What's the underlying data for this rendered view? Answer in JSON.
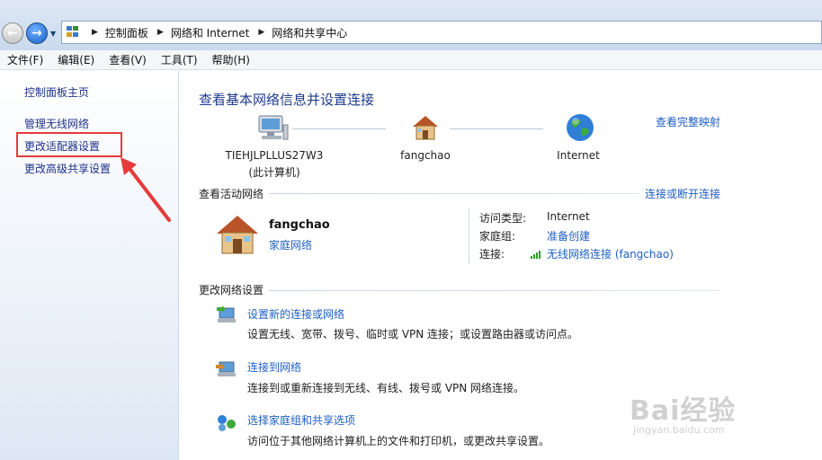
{
  "address_bar": {
    "crumbs": [
      "控制面板",
      "网络和 Internet",
      "网络和共享中心"
    ]
  },
  "menu": [
    "文件(F)",
    "编辑(E)",
    "查看(V)",
    "工具(T)",
    "帮助(H)"
  ],
  "sidebar": {
    "home": "控制面板主页",
    "items": [
      "管理无线网络",
      "更改适配器设置",
      "更改高级共享设置"
    ],
    "highlighted_item": "更改适配器设置",
    "highlight_color": "#e53b3b"
  },
  "main": {
    "title": "查看基本网络信息并设置连接",
    "full_map_link": "查看完整映射",
    "map": {
      "computer": {
        "name": "TIEHJLPLLUS27W3",
        "note": "(此计算机)"
      },
      "network": {
        "name": "fangchao"
      },
      "internet": {
        "name": "Internet"
      }
    },
    "active": {
      "heading": "查看活动网络",
      "link": "连接或断开连接",
      "network_name": "fangchao",
      "network_type": "家庭网络",
      "access_type_label": "访问类型:",
      "access_type_value": "Internet",
      "homegroup_label": "家庭组:",
      "homegroup_value": "准备创建",
      "connection_label": "连接:",
      "connection_value": "无线网络连接 (fangchao)"
    },
    "settings": {
      "heading": "更改网络设置",
      "tasks": [
        {
          "link": "设置新的连接或网络",
          "desc": "设置无线、宽带、拨号、临时或 VPN 连接；或设置路由器或访问点。"
        },
        {
          "link": "连接到网络",
          "desc": "连接到或重新连接到无线、有线、拨号或 VPN 网络连接。"
        },
        {
          "link": "选择家庭组和共享选项",
          "desc": "访问位于其他网络计算机上的文件和打印机，或更改共享设置。"
        }
      ]
    }
  },
  "watermark": {
    "main": "Bai经验",
    "sub": "jingyan.baidu.com"
  },
  "colors": {
    "link": "#1f5fc4",
    "title": "#1e3c8c",
    "sidebar_link": "#1e3287"
  }
}
